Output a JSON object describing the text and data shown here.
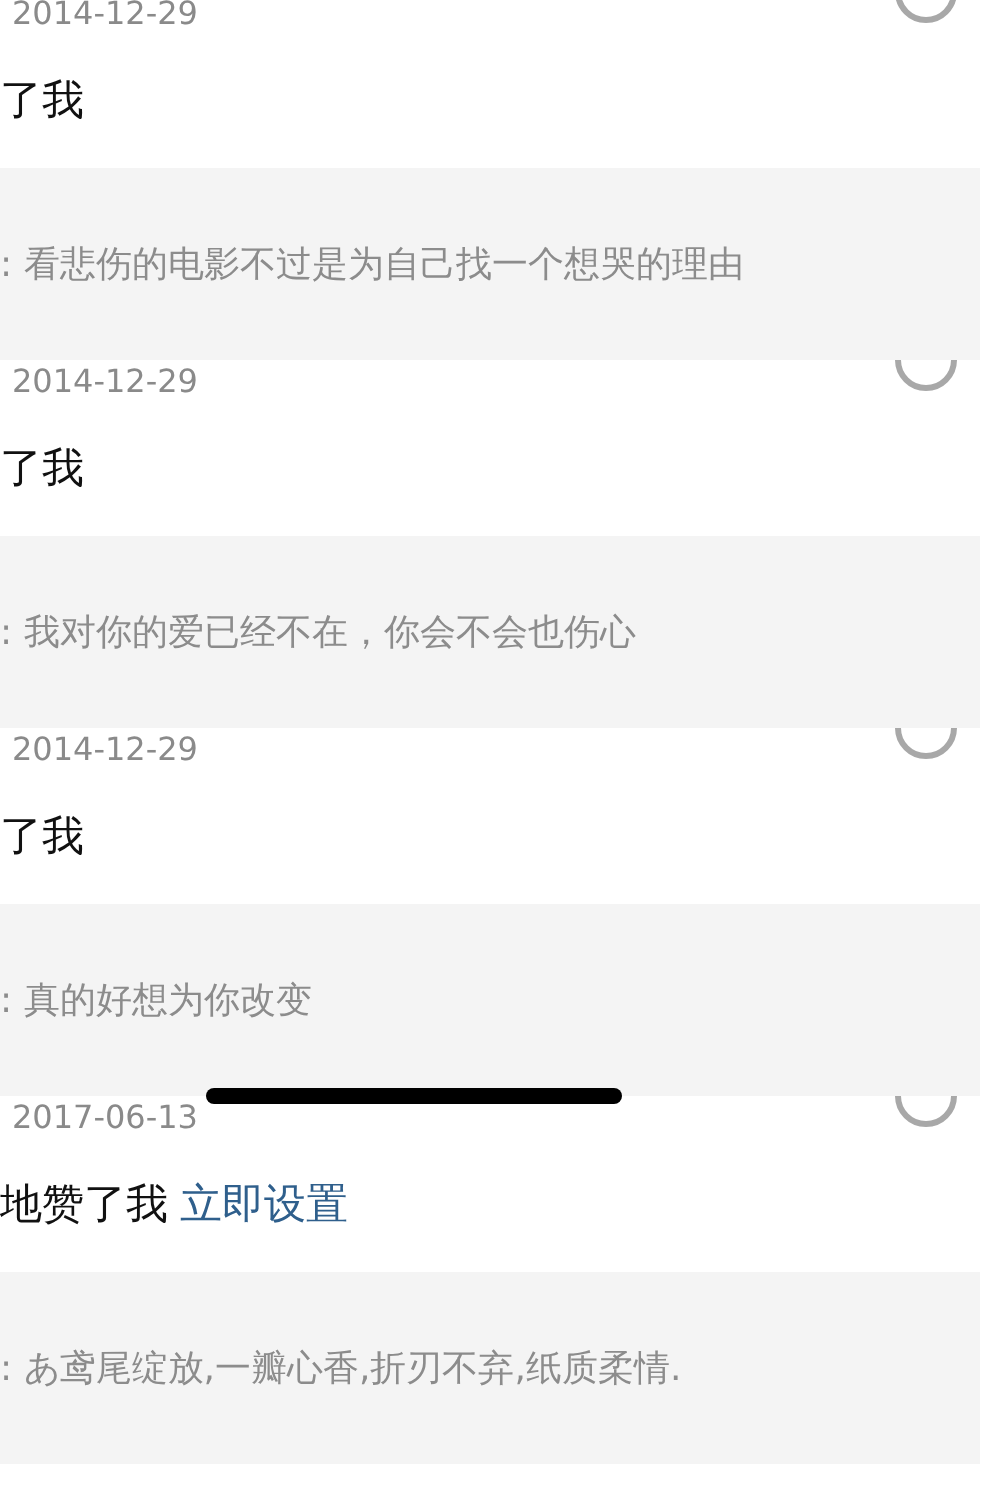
{
  "notifications": [
    {
      "date": "2014-12-29",
      "action": "了我",
      "quote": ": 看悲伤的电影不过是为自己找一个想哭的理由"
    },
    {
      "date": "2014-12-29",
      "action": "了我",
      "quote": ": 我对你的爱已经不在，你会不会也伤心"
    },
    {
      "date": "2014-12-29",
      "action": "了我",
      "quote": ": 真的好想为你改变"
    },
    {
      "date": "2017-06-13",
      "action": "地赞了我",
      "link": "立即设置",
      "quote": ": あ鸢尾绽放,一瓣心香,折刃不弃,纸质柔情."
    }
  ]
}
